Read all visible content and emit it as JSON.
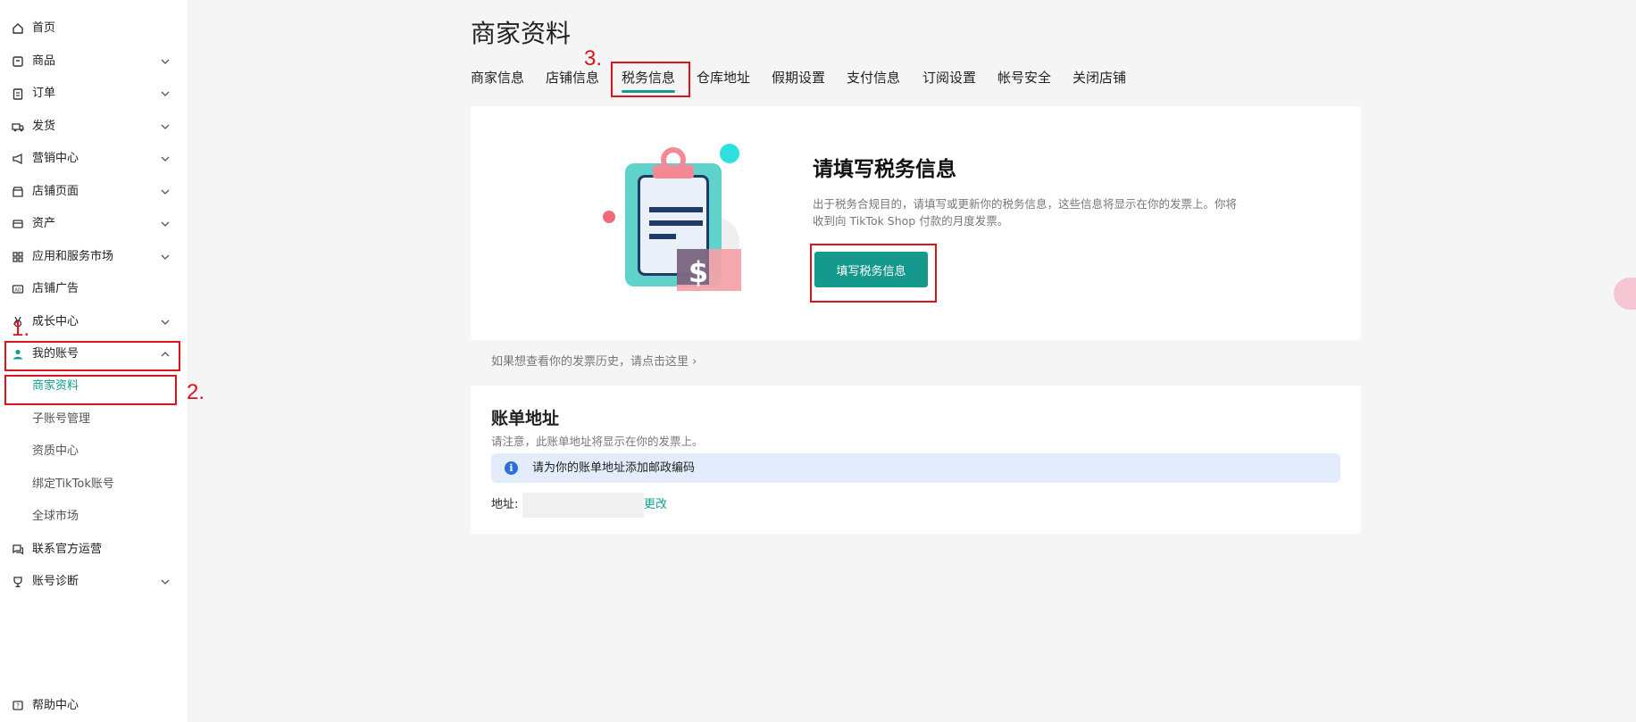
{
  "sidebar": {
    "items": [
      {
        "label": "首页"
      },
      {
        "label": "商品"
      },
      {
        "label": "订单"
      },
      {
        "label": "发货"
      },
      {
        "label": "营销中心"
      },
      {
        "label": "店铺页面"
      },
      {
        "label": "资产"
      },
      {
        "label": "应用和服务市场"
      },
      {
        "label": "店铺广告"
      },
      {
        "label": "成长中心"
      },
      {
        "label": "我的账号"
      }
    ],
    "sub_items": [
      {
        "label": "商家资料"
      },
      {
        "label": "子账号管理"
      },
      {
        "label": "资质中心"
      },
      {
        "label": "绑定TikTok账号"
      },
      {
        "label": "全球市场"
      }
    ],
    "bottom_items": [
      {
        "label": "联系官方运营"
      },
      {
        "label": "账号诊断"
      }
    ],
    "help": "帮助中心"
  },
  "annotations": {
    "one": "1.",
    "two": "2.",
    "three": "3."
  },
  "page_title": "商家资料",
  "tabs": [
    {
      "label": "商家信息"
    },
    {
      "label": "店铺信息"
    },
    {
      "label": "税务信息"
    },
    {
      "label": "仓库地址"
    },
    {
      "label": "假期设置"
    },
    {
      "label": "支付信息"
    },
    {
      "label": "订阅设置"
    },
    {
      "label": "帐号安全"
    },
    {
      "label": "关闭店铺"
    }
  ],
  "tax_card": {
    "title": "请填写税务信息",
    "description": "出于税务合规目的，请填写或更新你的税务信息，这些信息将显示在你的发票上。你将收到向 TikTok Shop 付款的月度发票。",
    "button": "填写税务信息",
    "illustration_symbol": "$"
  },
  "history_link": "如果想查看你的发票历史，请点击这里 ›",
  "billing": {
    "title": "账单地址",
    "note": "请注意，此账单地址将显示在你的发票上。",
    "alert_icon": "i",
    "alert": "请为你的账单地址添加邮政编码",
    "address_label": "地址:",
    "edit": "更改"
  },
  "colors": {
    "accent": "#14998c",
    "annotation_red": "#d9141c",
    "alert_bg": "#e2ecfb"
  }
}
